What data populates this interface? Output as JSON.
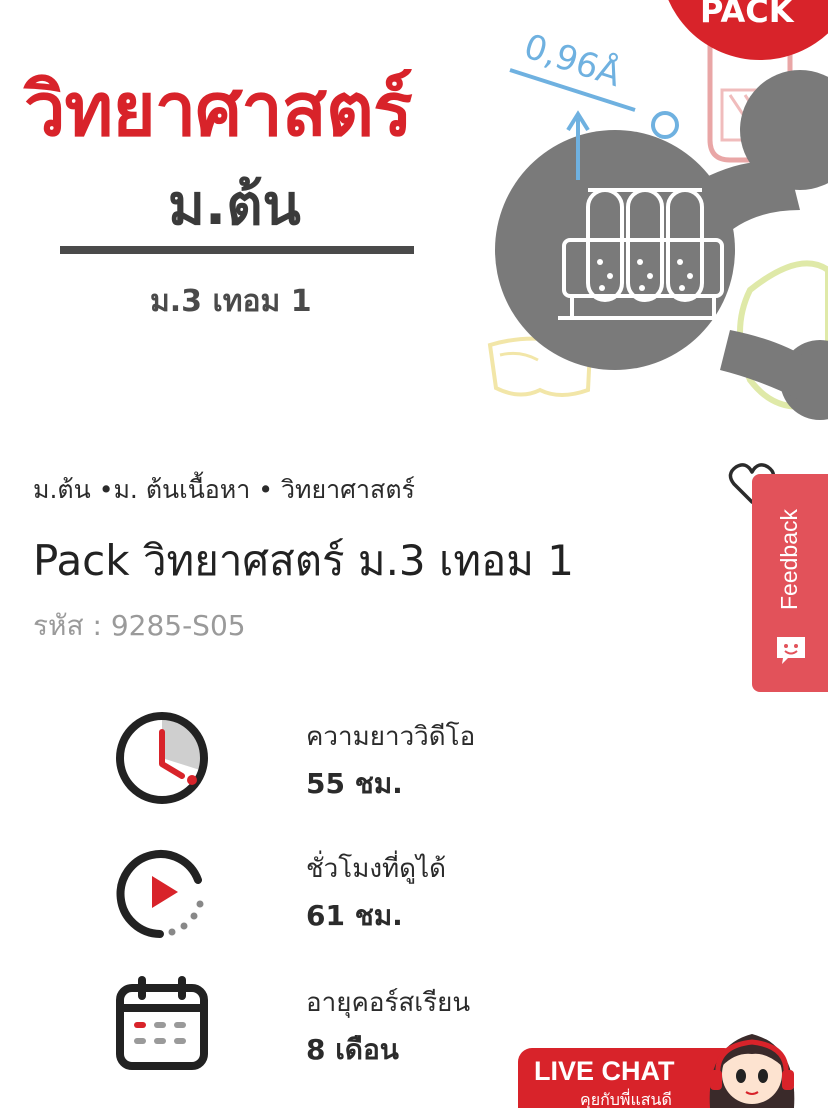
{
  "hero": {
    "title": "วิทยาศาสตร์",
    "level": "ม.ต้น",
    "term": "ม.3 เทอม 1",
    "badge": "PACK",
    "formula": "0,96Å"
  },
  "product": {
    "breadcrumb": "ม.ต้น •ม. ต้นเนื้อหา • วิทยาศาสตร์",
    "title": "Pack วิทยาศสตร์ ม.3 เทอม 1",
    "code": "รหัส : 9285-S05"
  },
  "stats": [
    {
      "label": "ความยาววิดีโอ",
      "value": "55 ชม.",
      "icon": "clock-icon"
    },
    {
      "label": "ชั่วโมงที่ดูได้",
      "value": "61 ชม.",
      "icon": "play-icon"
    },
    {
      "label": "อายุคอร์สเรียน",
      "value": "8 เดือน",
      "icon": "calendar-icon"
    }
  ],
  "feedback": {
    "label": "Feedback"
  },
  "livechat": {
    "title": "LIVE CHAT",
    "subtitle": "คุยกับพี่แสนดี"
  },
  "colors": {
    "brand_red": "#d8232a",
    "feedback_red": "#e2525a",
    "text_dark": "#2b2b2b",
    "text_muted": "#9a9a9a"
  }
}
